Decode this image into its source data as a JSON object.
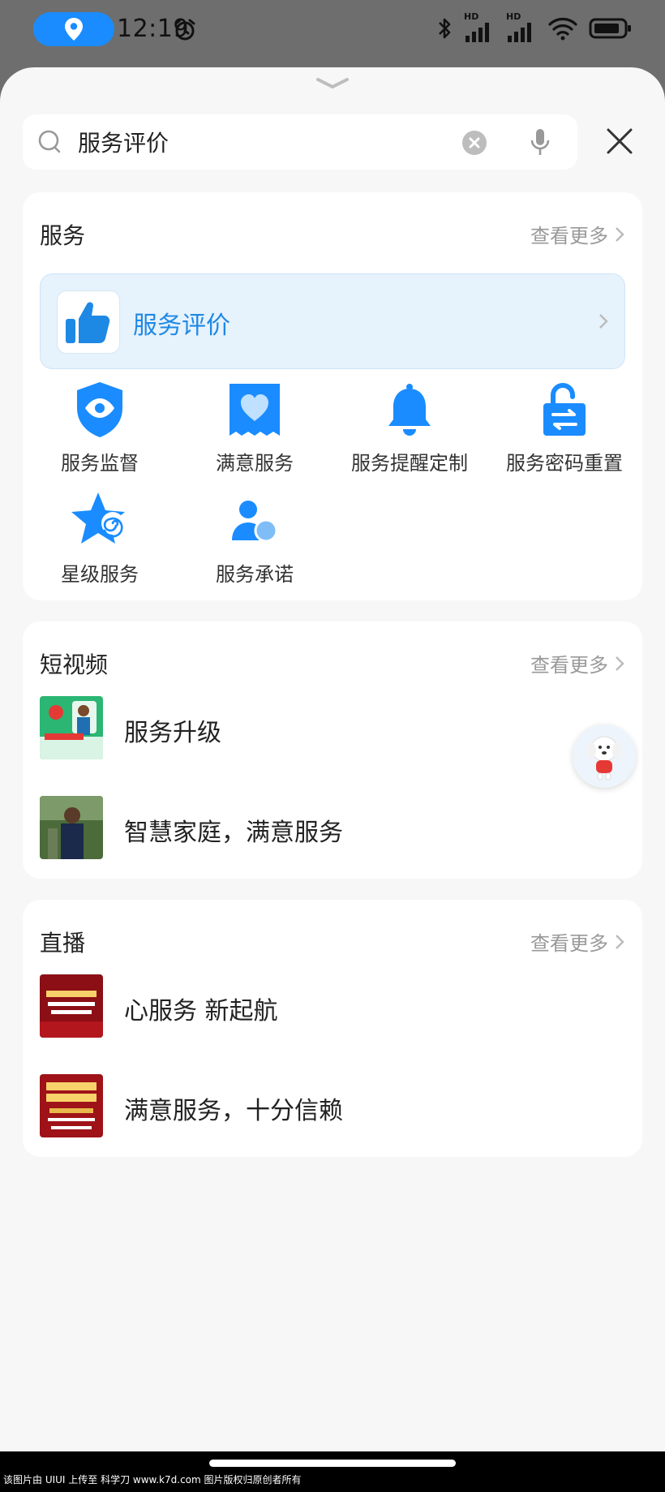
{
  "status_bar": {
    "time": "12:19",
    "hd1": "HD",
    "hd2": "HD"
  },
  "search": {
    "query": "服务评价"
  },
  "service": {
    "title": "服务",
    "more": "查看更多",
    "feature_label": "服务评价",
    "items": [
      {
        "label": "服务监督",
        "icon": "shield-eye-icon"
      },
      {
        "label": "满意服务",
        "icon": "heart-receipt-icon"
      },
      {
        "label": "服务提醒定制",
        "icon": "bell-icon"
      },
      {
        "label": "服务密码重置",
        "icon": "lock-swap-icon"
      },
      {
        "label": "星级服务",
        "icon": "star-swirl-icon"
      },
      {
        "label": "服务承诺",
        "icon": "person-badge-icon"
      }
    ]
  },
  "short_video": {
    "title": "短视频",
    "more": "查看更多",
    "items": [
      {
        "label": "服务升级"
      },
      {
        "label": "智慧家庭，满意服务"
      }
    ]
  },
  "live": {
    "title": "直播",
    "more": "查看更多",
    "items": [
      {
        "label": "心服务 新起航"
      },
      {
        "label": "满意服务，十分信赖"
      }
    ]
  },
  "footer": {
    "watermark": "该图片由 UIUI 上传至 科学刀 www.k7d.com 图片版权归原创者所有"
  },
  "colors": {
    "accent": "#1e88e5",
    "icon_blue": "#1a8cff",
    "muted": "#999999"
  }
}
